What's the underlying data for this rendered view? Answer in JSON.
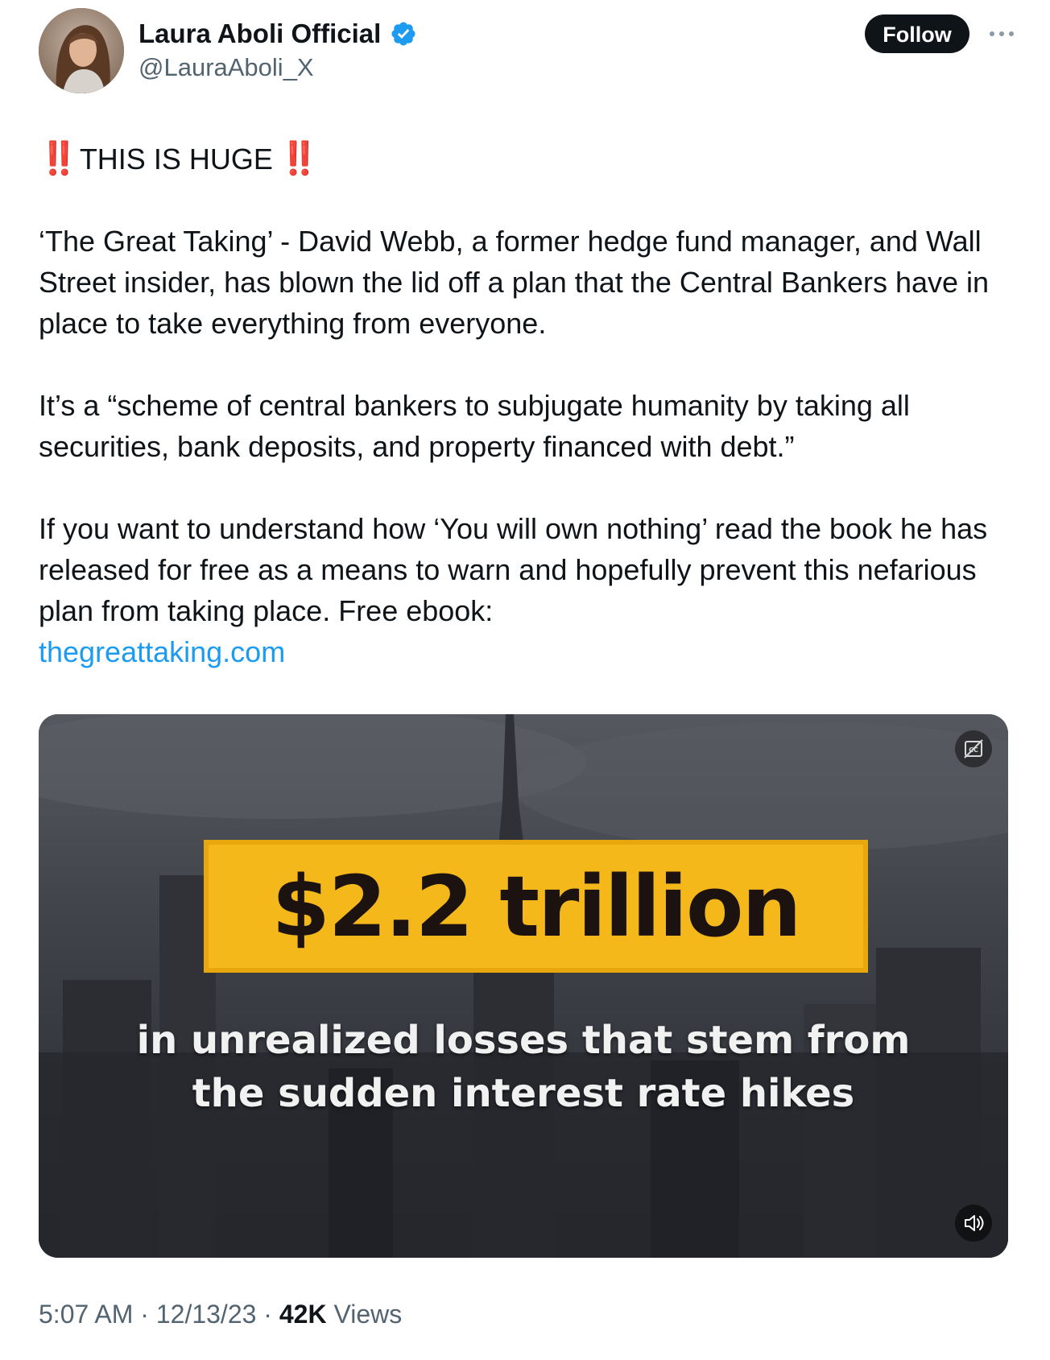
{
  "author": {
    "display_name": "Laura Aboli Official",
    "handle": "@LauraAboli_X",
    "verified": true
  },
  "actions": {
    "follow_label": "Follow",
    "more_icon": "more-dots-icon"
  },
  "tweet": {
    "headline_mark_left": "‼️",
    "headline_text": "THIS IS HUGE",
    "headline_mark_right": "‼️",
    "paragraph_1": "‘The Great Taking’ - David Webb, a former hedge fund manager, and Wall Street insider, has blown the lid off a plan that the Central Bankers have in place to take everything from everyone.",
    "paragraph_2": "It’s a “scheme of central bankers to subjugate humanity by taking all securities, bank deposits, and property financed with debt.”",
    "paragraph_3": "If you want to understand how ‘You will own nothing’ read the book he has released for free as a means to warn and hopefully prevent this nefarious plan from taking place. Free ebook:",
    "link_text": "thegreattaking.com"
  },
  "media": {
    "headline": "$2.2 trillion",
    "caption_line_1": "in unrealized losses that stem from",
    "caption_line_2": "the sudden interest rate hikes",
    "captions_icon": "closed-captions-icon",
    "sound_icon": "speaker-icon"
  },
  "meta": {
    "time": "5:07 AM",
    "separator": "·",
    "date": "12/13/23",
    "views_count": "42K",
    "views_label": "Views"
  },
  "colors": {
    "accent_link": "#1d9bf0",
    "verified_badge": "#1d9bf0",
    "follow_button_bg": "#0f1419",
    "headline_box": "#f5b81b",
    "alert_marks": "#e01a24"
  }
}
